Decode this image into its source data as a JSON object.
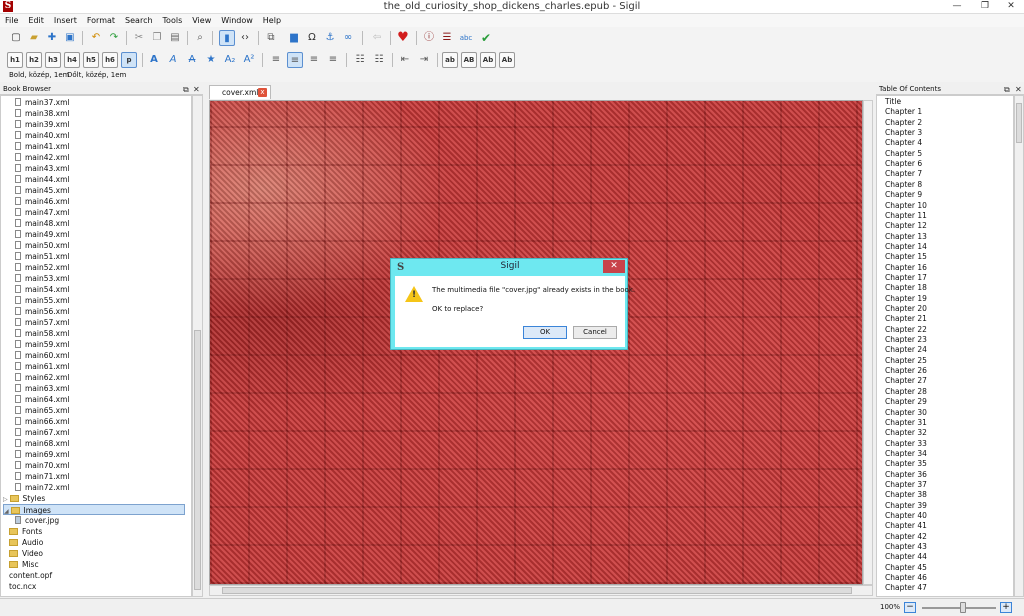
{
  "window": {
    "title": "the_old_curiosity_shop_dickens_charles.epub - Sigil",
    "logo": "S",
    "min": "—",
    "max": "❐",
    "close": "✕"
  },
  "menu": [
    "File",
    "Edit",
    "Insert",
    "Format",
    "Search",
    "Tools",
    "View",
    "Window",
    "Help"
  ],
  "toolbar2": {
    "h1": "h1",
    "h2": "h2",
    "h3": "h3",
    "h4": "h4",
    "h5": "h5",
    "h6": "h6",
    "p": "p",
    "ab1": "ab",
    "ab2": "AB",
    "ab3": "Ab",
    "ab4": "Ab"
  },
  "status_row": {
    "left": "Bold, közép,  1em",
    "right": "Dőlt, közép,  1em"
  },
  "book_browser": {
    "title": "Book Browser",
    "files": [
      "main37.xml",
      "main38.xml",
      "main39.xml",
      "main40.xml",
      "main41.xml",
      "main42.xml",
      "main43.xml",
      "main44.xml",
      "main45.xml",
      "main46.xml",
      "main47.xml",
      "main48.xml",
      "main49.xml",
      "main50.xml",
      "main51.xml",
      "main52.xml",
      "main53.xml",
      "main54.xml",
      "main55.xml",
      "main56.xml",
      "main57.xml",
      "main58.xml",
      "main59.xml",
      "main60.xml",
      "main61.xml",
      "main62.xml",
      "main63.xml",
      "main64.xml",
      "main65.xml",
      "main66.xml",
      "main67.xml",
      "main68.xml",
      "main69.xml",
      "main70.xml",
      "main71.xml",
      "main72.xml"
    ],
    "styles": "Styles",
    "images": "Images",
    "cover": "cover.jpg",
    "fonts": "Fonts",
    "audio": "Audio",
    "video": "Video",
    "misc": "Misc",
    "opf": "content.opf",
    "ncx": "toc.ncx"
  },
  "tab": {
    "label": "cover.xml",
    "close": "x"
  },
  "dialog": {
    "title": "Sigil",
    "logo": "S",
    "close": "✕",
    "message": "The multimedia file \"cover.jpg\" already exists in the book.",
    "question": "OK to replace?",
    "ok": "OK",
    "cancel": "Cancel"
  },
  "toc": {
    "title": "Table Of Contents",
    "items": [
      "Title",
      "Chapter 1",
      "Chapter 2",
      "Chapter 3",
      "Chapter 4",
      "Chapter 5",
      "Chapter 6",
      "Chapter 7",
      "Chapter 8",
      "Chapter 9",
      "Chapter 10",
      "Chapter 11",
      "Chapter 12",
      "Chapter 13",
      "Chapter 14",
      "Chapter 15",
      "Chapter 16",
      "Chapter 17",
      "Chapter 18",
      "Chapter 19",
      "Chapter 20",
      "Chapter 21",
      "Chapter 22",
      "Chapter 23",
      "Chapter 24",
      "Chapter 25",
      "Chapter 26",
      "Chapter 27",
      "Chapter 28",
      "Chapter 29",
      "Chapter 30",
      "Chapter 31",
      "Chapter 32",
      "Chapter 33",
      "Chapter 34",
      "Chapter 35",
      "Chapter 36",
      "Chapter 37",
      "Chapter 38",
      "Chapter 39",
      "Chapter 40",
      "Chapter 41",
      "Chapter 42",
      "Chapter 43",
      "Chapter 44",
      "Chapter 45",
      "Chapter 46",
      "Chapter 47"
    ]
  },
  "statusbar": {
    "zoom": "100%",
    "minus": "−",
    "plus": "+"
  },
  "colors": {
    "accent": "#3b84d8",
    "dialog_frame": "#6ee8f0",
    "close_red": "#c8434a"
  }
}
